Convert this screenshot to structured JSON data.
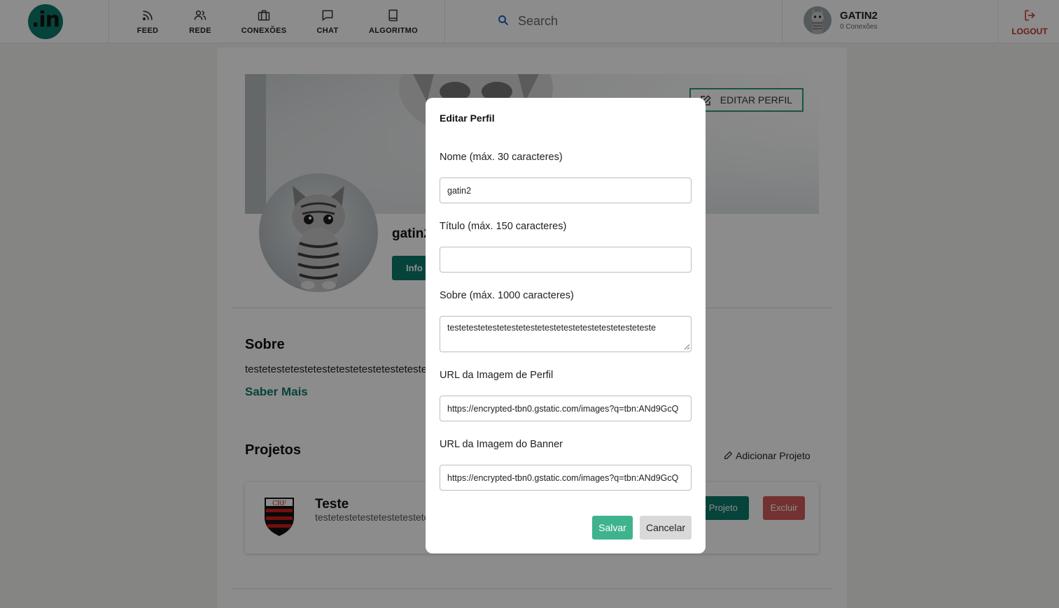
{
  "nav": {
    "logo": ".in",
    "items": [
      {
        "label": "FEED",
        "icon": "rss-icon"
      },
      {
        "label": "REDE",
        "icon": "users-icon"
      },
      {
        "label": "CONEXÕES",
        "icon": "briefcase-icon"
      },
      {
        "label": "CHAT",
        "icon": "chat-icon"
      },
      {
        "label": "ALGORITMO",
        "icon": "book-icon"
      }
    ],
    "search_placeholder": "Search",
    "user": {
      "name": "GATIN2",
      "connections": "0 Conexões"
    },
    "logout_label": "LOGOUT"
  },
  "profile": {
    "edit_label": "EDITAR PERFIL",
    "name": "gatin2",
    "info_button": "Info de contato"
  },
  "about": {
    "title": "Sobre",
    "text": "testetestetestetestetestetestetestetestetestetesteteste",
    "more": "Saber Mais"
  },
  "projects": {
    "title": "Projetos",
    "add_label": "Adicionar Projeto",
    "items": [
      {
        "title": "Teste",
        "description": "testetestetestetestetestetestetesteteste",
        "edit_label": "Editar Projeto",
        "delete_label": "Excluir"
      }
    ]
  },
  "modal": {
    "title": "Editar Perfil",
    "name_label": "Nome (máx. 30 caracteres)",
    "name_value": "gatin2",
    "title_label": "Título (máx. 150 caracteres)",
    "title_value": "",
    "about_label": "Sobre (máx. 1000 caracteres)",
    "about_value": "testetestetestetestetestetestetestetestetestetesteteste",
    "avatar_label": "URL da Imagem de Perfil",
    "avatar_value": "https://encrypted-tbn0.gstatic.com/images?q=tbn:ANd9GcQ",
    "banner_label": "URL da Imagem do Banner",
    "banner_value": "https://encrypted-tbn0.gstatic.com/images?q=tbn:ANd9GcQ",
    "save_label": "Salvar",
    "cancel_label": "Cancelar"
  },
  "colors": {
    "brand": "#0b7a6a",
    "save": "#3fb38e",
    "danger": "#d45a5a",
    "logout": "#c0392b"
  }
}
